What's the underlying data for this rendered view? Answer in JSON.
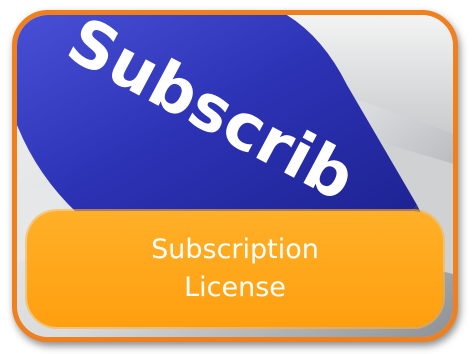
{
  "image": {
    "subject": "blue computer keyboard key",
    "key_text": "Subscrib"
  },
  "caption": {
    "line1": "Subscription",
    "line2": "License"
  },
  "colors": {
    "border": "#f07f1d",
    "caption_background": "#ffa51e",
    "key_blue": "#2a2fb0",
    "caption_text": "#ffffff"
  }
}
